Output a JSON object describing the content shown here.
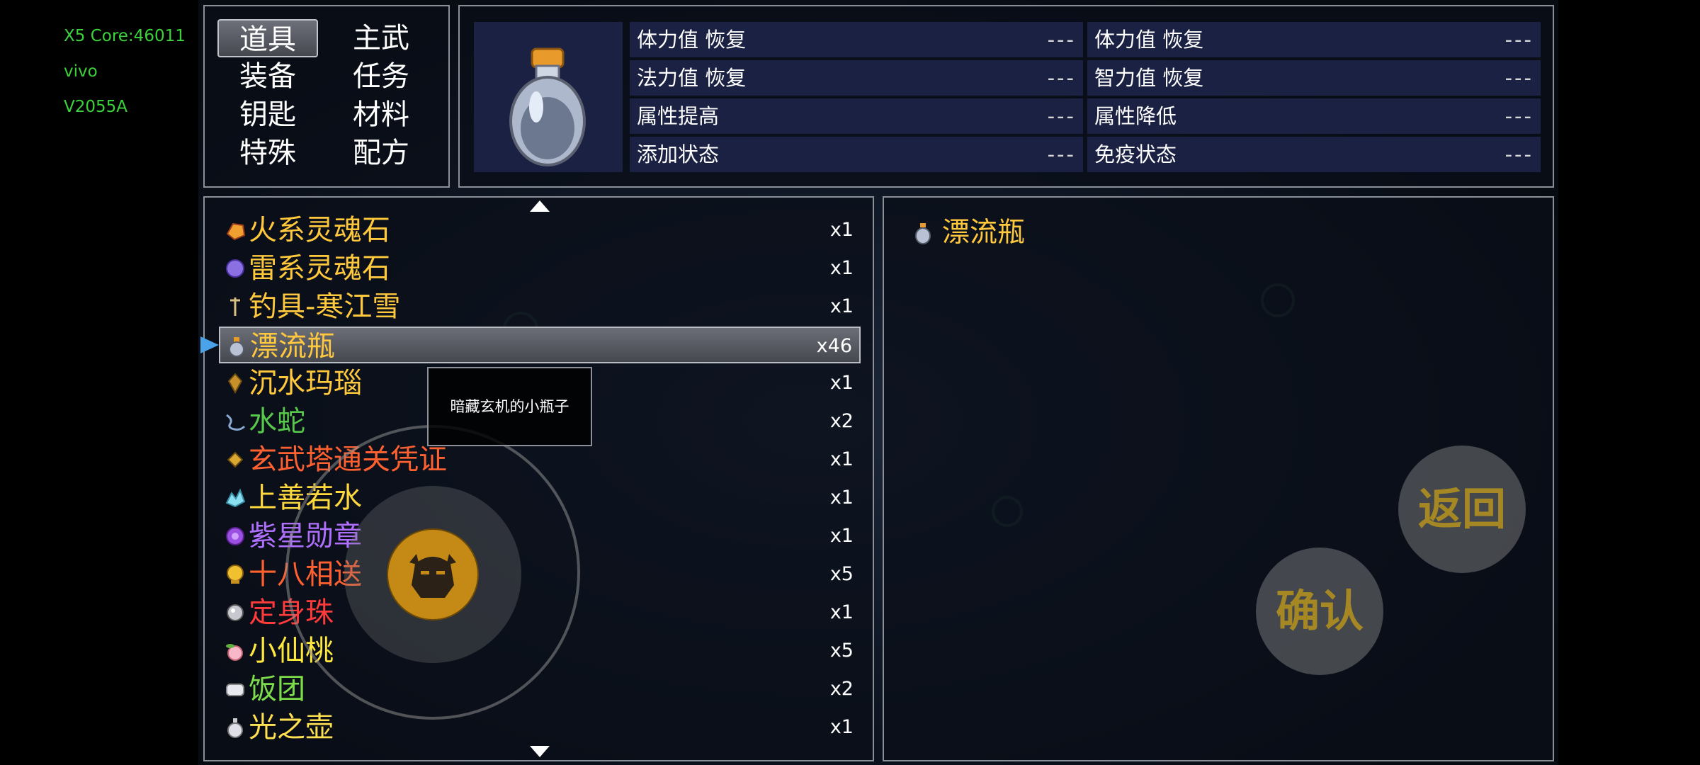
{
  "device_info": [
    "X5 Core:46011",
    "vivo",
    "V2055A"
  ],
  "categories": [
    {
      "label": "道具",
      "active": true
    },
    {
      "label": "主武"
    },
    {
      "label": "装备"
    },
    {
      "label": "任务"
    },
    {
      "label": "钥匙"
    },
    {
      "label": "材料"
    },
    {
      "label": "特殊"
    },
    {
      "label": "配方"
    }
  ],
  "stats": [
    {
      "label": "体力值 恢复",
      "value": "---"
    },
    {
      "label": "体力值 恢复",
      "value": "---"
    },
    {
      "label": "法力值 恢复",
      "value": "---"
    },
    {
      "label": "智力值 恢复",
      "value": "---"
    },
    {
      "label": "属性提高",
      "value": "---"
    },
    {
      "label": "属性降低",
      "value": "---"
    },
    {
      "label": "添加状态",
      "value": "---"
    },
    {
      "label": "免疫状态",
      "value": "---"
    }
  ],
  "items": [
    {
      "name": "火系灵魂石",
      "qty": "x1",
      "color": "#ffc83d",
      "icon": "fire-stone-icon"
    },
    {
      "name": "雷系灵魂石",
      "qty": "x1",
      "color": "#ffc83d",
      "icon": "thunder-stone-icon"
    },
    {
      "name": "钓具-寒江雪",
      "qty": "x1",
      "color": "#ffc83d",
      "icon": "fishing-rod-icon"
    },
    {
      "name": "漂流瓶",
      "qty": "x46",
      "color": "#ffc83d",
      "icon": "bottle-icon",
      "selected": true
    },
    {
      "name": "沉水玛瑙",
      "qty": "x1",
      "color": "#ffc83d",
      "icon": "agate-icon"
    },
    {
      "name": "水蛇",
      "qty": "x2",
      "color": "#56c84a",
      "icon": "water-snake-icon"
    },
    {
      "name": "玄武塔通关凭证",
      "qty": "x1",
      "color": "#ff6030",
      "icon": "token-icon"
    },
    {
      "name": "上善若水",
      "qty": "x1",
      "color": "#ffd83d",
      "icon": "crystal-icon"
    },
    {
      "name": "紫星勋章",
      "qty": "x1",
      "color": "#b070ff",
      "icon": "purple-medal-icon"
    },
    {
      "name": "十八相送",
      "qty": "x5",
      "color": "#ff6030",
      "icon": "gold-coin-icon"
    },
    {
      "name": "定身珠",
      "qty": "x1",
      "color": "#ff3b3b",
      "icon": "pearl-icon"
    },
    {
      "name": "小仙桃",
      "qty": "x5",
      "color": "#ffe83d",
      "icon": "peach-icon"
    },
    {
      "name": "饭团",
      "qty": "x2",
      "color": "#7ddc4a",
      "icon": "rice-ball-icon"
    },
    {
      "name": "光之壶",
      "qty": "x1",
      "color": "#ffe050",
      "icon": "light-pot-icon"
    }
  ],
  "tooltip": "暗藏玄机的小瓶子",
  "detail": {
    "name": "漂流瓶",
    "icon": "bottle-icon"
  },
  "buttons": {
    "back": "返回",
    "confirm": "确认"
  }
}
